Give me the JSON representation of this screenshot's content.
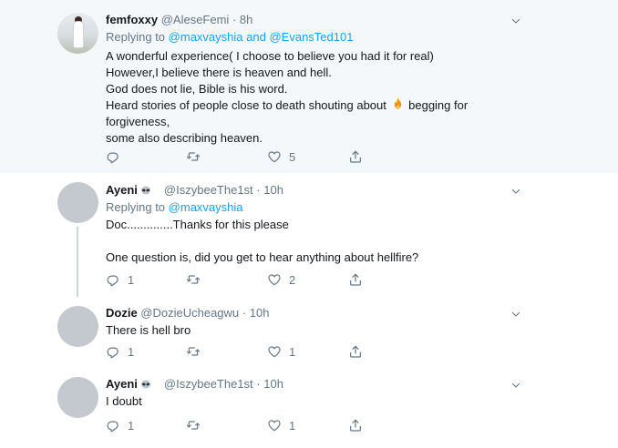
{
  "tweets": [
    {
      "name": "femfoxxy",
      "handle": "@AleseFemi",
      "dot": "·",
      "time": "8h",
      "replying_prefix": "Replying to",
      "replying_to_1": "@maxvayshia",
      "replying_and": "and",
      "replying_to_2": "@EvansTed101",
      "lines": [
        "A  wonderful experience( I choose to believe you had it for real)",
        "However,I believe  there is heaven and hell.",
        "God does not lie, Bible is his word.",
        "Heard stories of people close to death shouting about",
        "begging for",
        "forgiveness,",
        "some also describing heaven."
      ],
      "reply_count": "",
      "retweet_count": "",
      "like_count": "5"
    },
    {
      "name": "Ayeni",
      "handle": "@IszybeeThe1st",
      "dot": "·",
      "time": "10h",
      "replying_prefix": "Replying to",
      "replying_to_1": "@maxvayshia",
      "lines": [
        "Doc..............Thanks for this please",
        "One question is, did you get to hear anything about hellfire?"
      ],
      "reply_count": "1",
      "retweet_count": "",
      "like_count": "2"
    },
    {
      "name": "Dozie",
      "handle": "@DozieUcheagwu",
      "dot": "·",
      "time": "10h",
      "lines": [
        "There is hell bro"
      ],
      "reply_count": "1",
      "retweet_count": "",
      "like_count": "1"
    },
    {
      "name": "Ayeni",
      "handle": "@IszybeeThe1st",
      "dot": "·",
      "time": "10h",
      "lines": [
        "I doubt"
      ],
      "reply_count": "1",
      "retweet_count": "",
      "like_count": "1"
    }
  ],
  "icons": {
    "reply": "reply-icon",
    "retweet": "retweet-icon",
    "like": "heart-icon",
    "share": "share-icon",
    "menu": "chevron-down-icon",
    "emoji_alien": "alien-emoji-icon",
    "emoji_fire": "fire-emoji-icon"
  },
  "colors": {
    "link": "#1da1f2",
    "secondary_text": "#657786",
    "highlight_background": "#f5f8fa",
    "thread_line": "#ccd6dd"
  }
}
